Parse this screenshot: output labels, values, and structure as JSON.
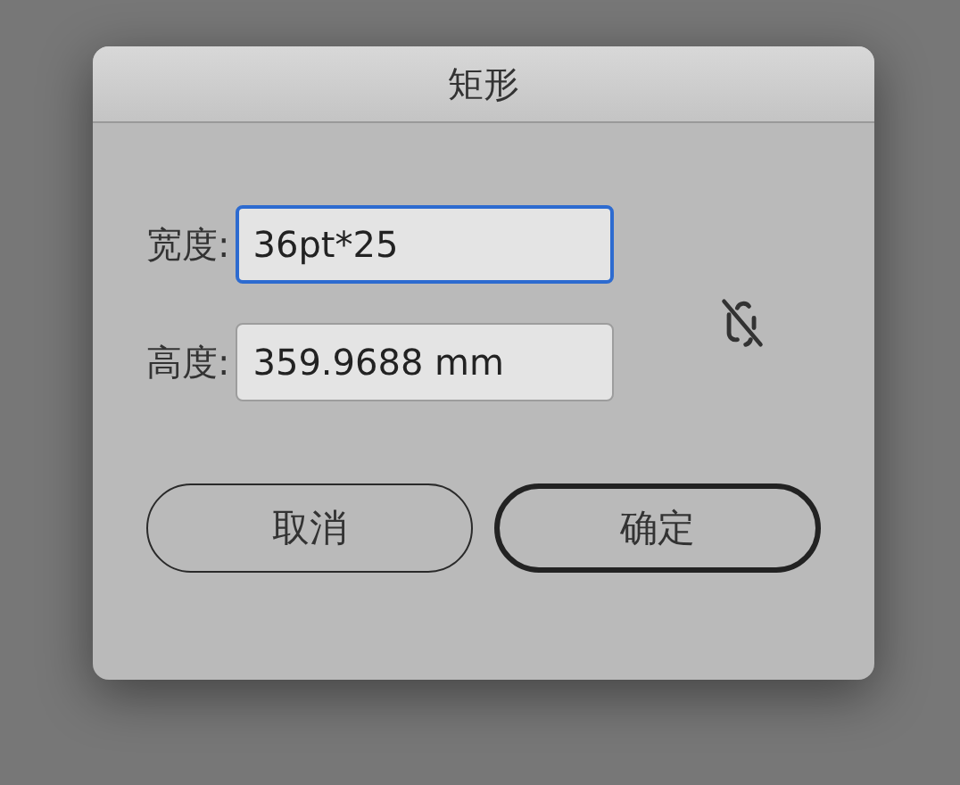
{
  "window": {
    "title": "矩形"
  },
  "fields": [
    {
      "label": "宽度:",
      "value": "36pt*25",
      "focused": true
    },
    {
      "label": "高度:",
      "value": "359.9688 mm",
      "focused": false
    }
  ],
  "proportions_linked": false,
  "buttons": [
    {
      "label": "取消",
      "default": false
    },
    {
      "label": "确定",
      "default": true
    }
  ]
}
